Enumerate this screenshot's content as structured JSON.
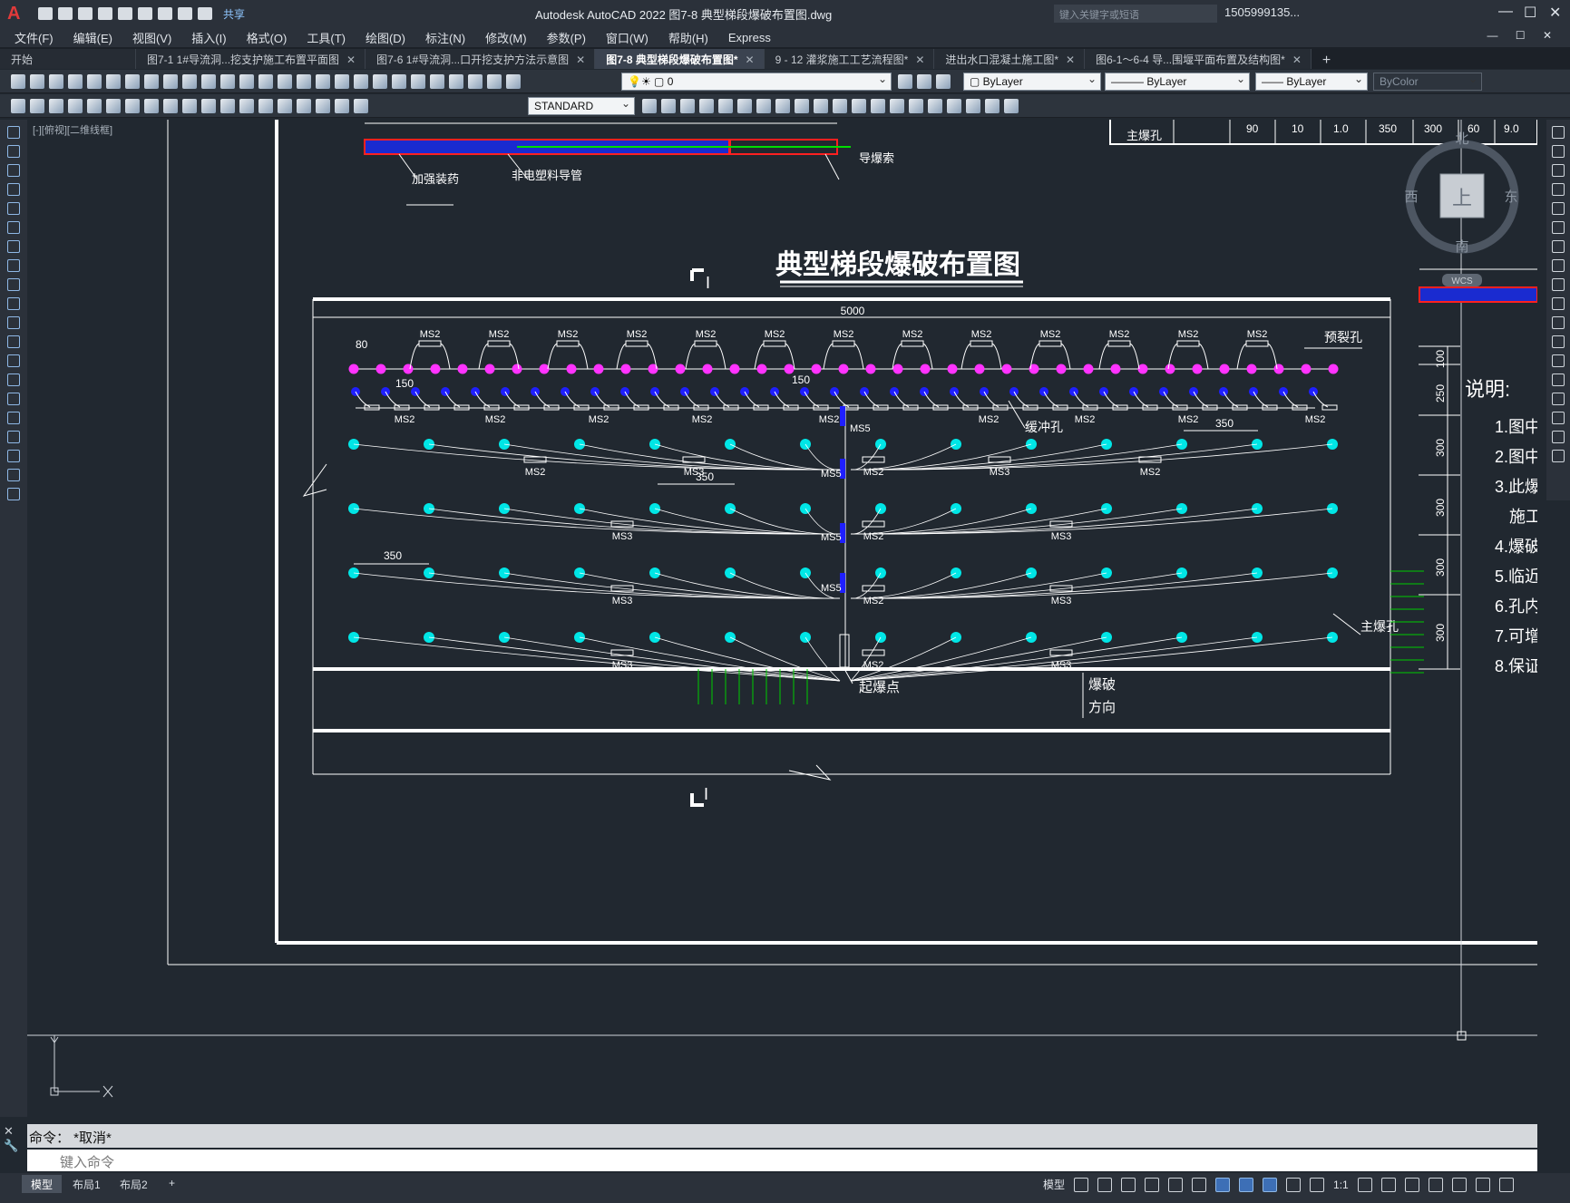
{
  "app": {
    "window_title": "Autodesk AutoCAD 2022    图7-8 典型梯段爆破布置图.dwg",
    "share_label": "共享",
    "search_placeholder": "键入关键字或短语",
    "user_name": "1505999135...",
    "logo_letter": "A"
  },
  "menus": [
    "文件(F)",
    "编辑(E)",
    "视图(V)",
    "插入(I)",
    "格式(O)",
    "工具(T)",
    "绘图(D)",
    "标注(N)",
    "修改(M)",
    "参数(P)",
    "窗口(W)",
    "帮助(H)",
    "Express"
  ],
  "tabs": [
    {
      "label": "开始",
      "closable": false,
      "active": false
    },
    {
      "label": "图7-1 1#导流洞...挖支护施工布置平面图",
      "closable": true,
      "active": false
    },
    {
      "label": "图7-6 1#导流洞...口开挖支护方法示意图",
      "closable": true,
      "active": false
    },
    {
      "label": "图7-8 典型梯段爆破布置图*",
      "closable": true,
      "active": true
    },
    {
      "label": "9 - 12 灌浆施工工艺流程图*",
      "closable": true,
      "active": false
    },
    {
      "label": "进出水口混凝土施工图*",
      "closable": true,
      "active": false
    },
    {
      "label": "图6-1～6-4 导...围堰平面布置及结构图*",
      "closable": true,
      "active": false
    }
  ],
  "toolbar": {
    "layer_value": "0",
    "color_value": "ByLayer",
    "linetype_value": "ByLayer",
    "lineweight_value": "ByLayer",
    "plotstyle_value": "ByColor",
    "textstyle_value": "STANDARD"
  },
  "viewport": {
    "label": "[-][俯视][二维线框]",
    "compass": {
      "north": "北",
      "south": "南",
      "east": "东",
      "west": "西",
      "center": "上",
      "wcs": "WCS"
    }
  },
  "drawing": {
    "title": "典型梯段爆破布置图",
    "section_mark": "I",
    "top_labels": {
      "charge": "加强装药",
      "tube": "非电塑料导管",
      "cord": "导爆索"
    },
    "top_table": {
      "row_label": "主爆孔",
      "values": [
        "90",
        "10",
        "1.0",
        "350",
        "300",
        "60",
        "9.0"
      ]
    },
    "dims": {
      "width": "5000",
      "d80": "80",
      "d150a": "150",
      "d150b": "150",
      "d350a": "350",
      "d350b": "350",
      "d350c": "350"
    },
    "right_dims": [
      "100",
      "250",
      "300",
      "300",
      "300",
      "300"
    ],
    "labels": {
      "presplit": "预裂孔",
      "buffer": "缓冲孔",
      "main": "主爆孔",
      "ignition": "起爆点",
      "direction_1": "爆破",
      "direction_2": "方向"
    },
    "delays": {
      "ms2": "MS2",
      "ms3": "MS3",
      "ms5": "MS5"
    },
    "notes_title": "说明:",
    "notes": [
      "1.图中",
      "2.图中",
      "3.此爆",
      "施工",
      "4.爆破",
      "5.临近",
      "6.孔内",
      "7.可增",
      "8.保证"
    ]
  },
  "command": {
    "history": "命令： *取消*",
    "placeholder": "键入命令"
  },
  "status": {
    "layouts": [
      "模型",
      "布局1",
      "布局2"
    ],
    "model_label": "模型",
    "scale": "1:1"
  },
  "colors": {
    "presplit": "#ff33ff",
    "buffer": "#1f1fff",
    "main": "#00e6e6",
    "redline": "#ff2020",
    "green": "#00cc00"
  }
}
